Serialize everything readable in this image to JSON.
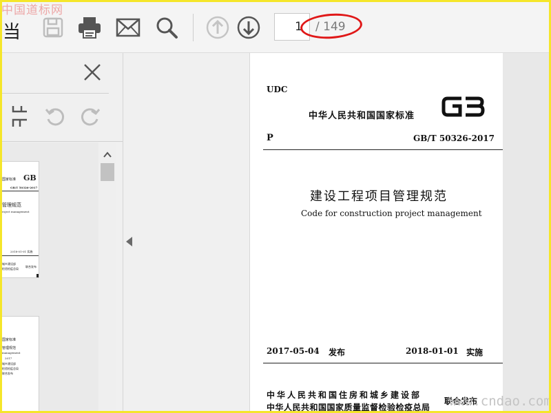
{
  "watermark_text": "中国道标网",
  "toolbar": {
    "left_fragment": "当",
    "save_icon": "save-icon",
    "print_icon": "print-icon",
    "mail_icon": "mail-icon",
    "search_icon": "search-icon",
    "prev_icon": "arrow-up-circle-icon",
    "next_icon": "arrow-down-circle-icon",
    "current_page": "1",
    "total_pages": "/ 149"
  },
  "sidebar": {
    "close_icon": "close-icon",
    "tool_icons": [
      "split-view-icon",
      "rotate-left-icon",
      "rotate-right-icon"
    ],
    "thumb1": {
      "std_line": "国家标准",
      "code": "GB/T 50326-2017",
      "title": "管理规范",
      "subtitle": "roject management",
      "dates": "2018-01-01 实施",
      "issuer1": "城乡建设部",
      "issuer2": "检验检疫总局",
      "issue": "联合发布"
    },
    "thumb2": {
      "line1": "国家标准",
      "line2": "管理规范",
      "line3": "management",
      "line4": "2017",
      "line5": "城乡建设部",
      "line6": "检验检疫总局",
      "line7": "联合发布"
    }
  },
  "document": {
    "udc": "UDC",
    "national_standard": "中华人民共和国国家标准",
    "p_label": "P",
    "code": "GB/T 50326-2017",
    "title_cn": "建设工程项目管理规范",
    "title_en": "Code for construction project management",
    "issue_date": "2017-05-04",
    "issue_label": "发布",
    "impl_date": "2018-01-01",
    "impl_label": "实施",
    "issuer1": "中华人民共和国住房和城乡建设部",
    "issuer2": "中华人民共和国国家质量监督检验检疫总局",
    "joint_issue": "联合发布"
  },
  "corner_watermark": "www.cndao.com",
  "colors": {
    "frame": "#f5e62a",
    "highlight": "#e01818"
  }
}
